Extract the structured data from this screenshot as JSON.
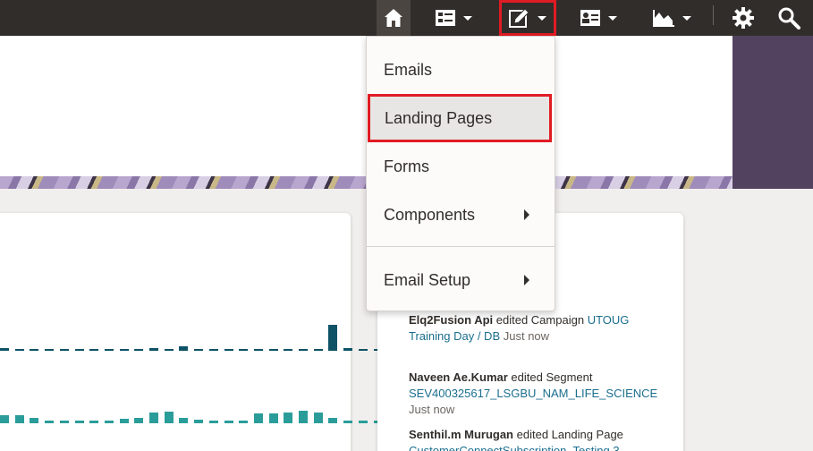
{
  "nav": {
    "home": {
      "icon": "home-icon"
    },
    "campaigns": {
      "icon": "campaigns-icon"
    },
    "assets": {
      "icon": "pencil-icon"
    },
    "contacts": {
      "icon": "contact-card-icon"
    },
    "insights": {
      "icon": "area-chart-icon"
    },
    "settings": {
      "icon": "gear-icon"
    },
    "search": {
      "icon": "search-icon"
    }
  },
  "assets_menu": {
    "items": [
      {
        "label": "Emails",
        "has_submenu": false
      },
      {
        "label": "Landing Pages",
        "has_submenu": false,
        "highlighted": true
      },
      {
        "label": "Forms",
        "has_submenu": false
      },
      {
        "label": "Components",
        "has_submenu": true
      },
      {
        "label": "Email Setup",
        "has_submenu": true
      }
    ]
  },
  "activity": [
    {
      "who": "Elq2Fusion Api",
      "action": "edited Campaign",
      "target_a": "UTOUG",
      "target_b": "Training Day / DB",
      "when": "Just now"
    },
    {
      "who": "Naveen Ae.Kumar",
      "action": "edited Segment",
      "target": "SEV400325617_LSGBU_NAM_LIFE_SCIENCE",
      "when": "Just now"
    },
    {
      "who": "Senthil.m Murugan",
      "action": "edited Landing Page",
      "target": "CustomerConnectSubscription_Testing 3"
    }
  ],
  "colors": {
    "topbar": "#312d2a",
    "highlight": "#e01b24",
    "bar_dark": "#0e5266",
    "bar_teal": "#2a9d9a",
    "link": "#1a6e8e"
  }
}
